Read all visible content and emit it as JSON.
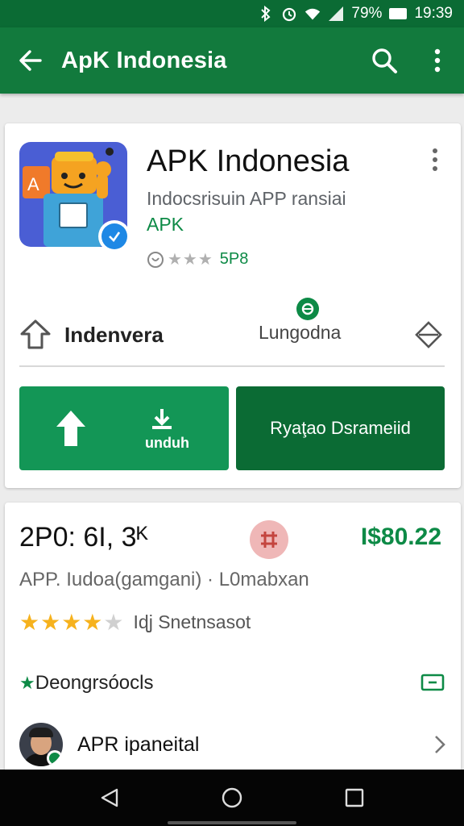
{
  "status_bar": {
    "battery": "79%",
    "time": "19:39"
  },
  "app_bar": {
    "title": "ApK Indonesia"
  },
  "app": {
    "title": "APK Indonesia",
    "subtitle": "Indocsrisuin APP ransiai",
    "category": "APK",
    "rating_count": "5P8"
  },
  "share_row": {
    "label": "Indenvera",
    "language": "Lungodna"
  },
  "buttons": {
    "install_label": "unduh",
    "detail_label": "Ryaţao Dsrameiid"
  },
  "info": {
    "count": "2P0: 6I, 3ᴷ",
    "price": "I$80.22",
    "meta": "APP. Iudoa(ɡamgani) · L0mabxan",
    "rating_stars": 4.5,
    "rating_text": "Iɖj Snetnsasot",
    "description": "Deongrsóocls",
    "developer": "APR ipaneital"
  },
  "colors": {
    "brand_dark": "#0b6b34",
    "brand": "#127a3d",
    "accent": "#139656",
    "text_green": "#0d8a46",
    "star": "#f6b21d"
  },
  "icons": [
    "bluetooth-icon",
    "alarm-icon",
    "wifi-icon",
    "signal-icon",
    "battery-icon",
    "back-arrow-icon",
    "search-icon",
    "more-vert-icon",
    "verified-badge-icon",
    "share-icon",
    "language-icon",
    "diamond-icon",
    "upload-arrow-icon",
    "download-icon",
    "tag-icon",
    "chat-icon",
    "chevron-right-icon",
    "nav-back-icon",
    "nav-home-icon",
    "nav-recents-icon"
  ]
}
